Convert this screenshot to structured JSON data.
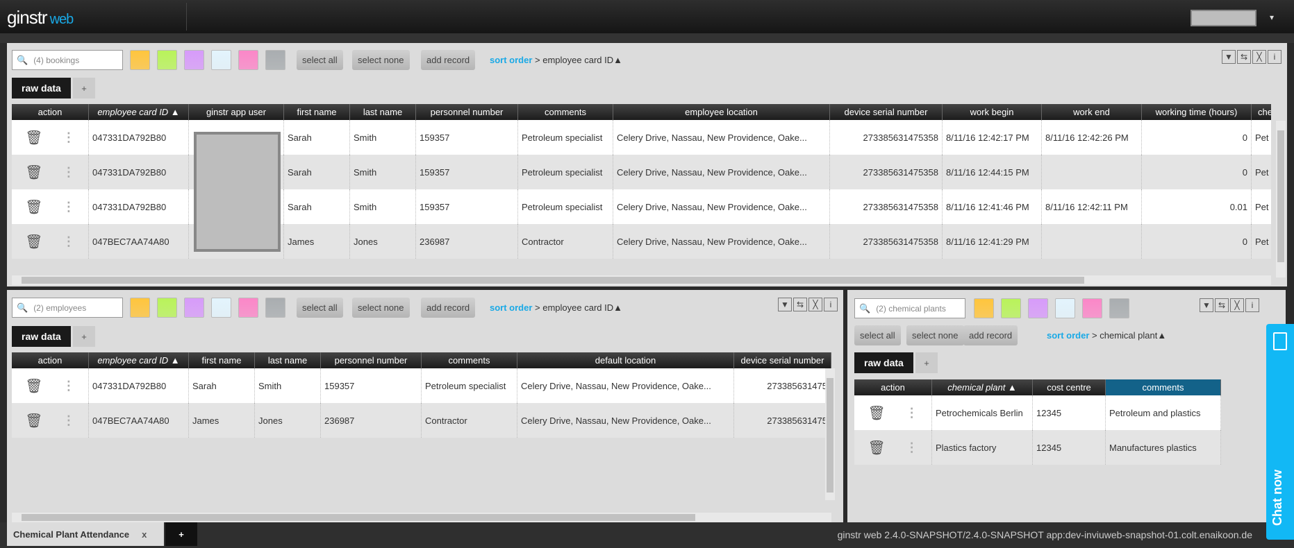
{
  "header": {
    "logo": "ginstr",
    "logo_suffix": "web",
    "user_menu": "▾"
  },
  "swatches": [
    "#ffc53d",
    "#b9f35a",
    "#d79bfa",
    "#e3f4fd",
    "#fb87c8",
    "#a9adb0"
  ],
  "toolbar": {
    "select_all": "select all",
    "select_none": "select none",
    "add_record": "add record",
    "sort_label": "sort order",
    "sort_sep": " > ",
    "sort_arrow": "▲",
    "tab_label": "raw data",
    "tab_add": "+",
    "icons": [
      "filter-icon",
      "swap-columns-icon",
      "clear-icon",
      "info-icon"
    ],
    "icon_glyphs": [
      "▼",
      "⇆",
      "╳",
      "i"
    ]
  },
  "bookings": {
    "search_placeholder": "(4) bookings",
    "sort_field": "employee card ID",
    "columns": [
      "action",
      "employee card ID ▲",
      "ginstr app user",
      "first name",
      "last name",
      "personnel number",
      "comments",
      "employee location",
      "device serial number",
      "work begin",
      "work end",
      "working time (hours)",
      "che"
    ],
    "rows": [
      [
        "",
        "047331DA792B80",
        "",
        "Sarah",
        "Smith",
        "159357",
        "Petroleum specialist",
        "Celery Drive, Nassau, New Providence, Oake...",
        "273385631475358",
        "8/11/16 12:42:17 PM",
        "8/11/16 12:42:26 PM",
        "0",
        "Pet"
      ],
      [
        "",
        "047331DA792B80",
        "",
        "Sarah",
        "Smith",
        "159357",
        "Petroleum specialist",
        "Celery Drive, Nassau, New Providence, Oake...",
        "273385631475358",
        "8/11/16 12:44:15 PM",
        "",
        "0",
        "Pet"
      ],
      [
        "",
        "047331DA792B80",
        "",
        "Sarah",
        "Smith",
        "159357",
        "Petroleum specialist",
        "Celery Drive, Nassau, New Providence, Oake...",
        "273385631475358",
        "8/11/16 12:41:46 PM",
        "8/11/16 12:42:11 PM",
        "0.01",
        "Pet"
      ],
      [
        "",
        "047BEC7AA74A80",
        "",
        "James",
        "Jones",
        "236987",
        "Contractor",
        "Celery Drive, Nassau, New Providence, Oake...",
        "273385631475358",
        "8/11/16 12:41:29 PM",
        "",
        "0",
        "Pet"
      ]
    ]
  },
  "employees": {
    "search_placeholder": "(2) employees",
    "sort_field": "employee card ID",
    "columns": [
      "action",
      "employee card ID ▲",
      "first name",
      "last name",
      "personnel number",
      "comments",
      "default location",
      "device serial number"
    ],
    "rows": [
      [
        "",
        "047331DA792B80",
        "Sarah",
        "Smith",
        "159357",
        "Petroleum specialist",
        "Celery Drive, Nassau, New Providence, Oake...",
        "273385631475"
      ],
      [
        "",
        "047BEC7AA74A80",
        "James",
        "Jones",
        "236987",
        "Contractor",
        "Celery Drive, Nassau, New Providence, Oake...",
        "273385631475"
      ]
    ]
  },
  "plants": {
    "search_placeholder": "(2) chemical plants",
    "sort_field": "chemical plant",
    "columns": [
      "action",
      "chemical plant ▲",
      "cost centre",
      "comments"
    ],
    "rows": [
      [
        "",
        "Petrochemicals Berlin",
        "12345",
        "Petroleum and plastics"
      ],
      [
        "",
        "Plastics factory",
        "12345",
        "Manufactures plastics"
      ]
    ]
  },
  "footer": {
    "tab": "Chemical Plant Attendance",
    "tab_close": "x",
    "tab_add": "+",
    "version": "ginstr web 2.4.0-SNAPSHOT/2.4.0-SNAPSHOT app:dev-inviuweb-snapshot-01.colt.enaikoon.de"
  },
  "chat": {
    "label": "Chat now"
  }
}
